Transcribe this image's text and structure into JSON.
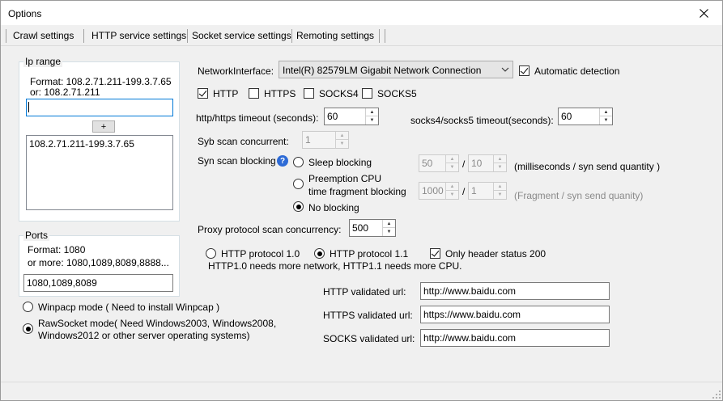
{
  "window": {
    "title": "Options",
    "close_icon": "close-icon"
  },
  "menu": [
    "Crawl settings",
    "HTTP service settings",
    "Socket service settings",
    "Remoting settings"
  ],
  "ip_range": {
    "group_label": "Ip range",
    "format_line1": "Format: 108.2.71.211-199.3.7.65",
    "format_line2": "or: 108.2.71.211",
    "input_value": "",
    "add_button": "+",
    "list_items": [
      "108.2.71.211-199.3.7.65"
    ]
  },
  "ports": {
    "group_label": "Ports",
    "format_line1": "Format: 1080",
    "format_line2": "or more: 1080,1089,8089,8888...",
    "input_value": "1080,1089,8089"
  },
  "capture_mode": {
    "winpcap_label": "Winpacp mode ( Need to install Winpcap )",
    "rawsocket_line1": "RawSocket mode( Need Windows2003, Windows2008,",
    "rawsocket_line2": "Windows2012 or other server operating systems)",
    "selected": "rawsocket"
  },
  "network": {
    "label": "NetworkInterface:",
    "value": "Intel(R) 82579LM Gigabit Network Connection",
    "auto_detect_label": "Automatic detection",
    "auto_detect_checked": true
  },
  "protocols": [
    {
      "label": "HTTP",
      "checked": true
    },
    {
      "label": "HTTPS",
      "checked": false
    },
    {
      "label": "SOCKS4",
      "checked": false
    },
    {
      "label": "SOCKS5",
      "checked": false
    }
  ],
  "timeouts": {
    "http_label": "http/https timeout (seconds):",
    "http_value": "60",
    "socks_label": "socks4/socks5 timeout(seconds):",
    "socks_value": "60"
  },
  "syn": {
    "concurrent_label": "Syb scan concurrent:",
    "concurrent_value": "1",
    "blocking_label": "Syn scan blocking",
    "help_icon": "help-icon",
    "sleep_label": "Sleep blocking",
    "sleep_ms": "50",
    "sleep_qty": "10",
    "sleep_hint": "(milliseconds / syn send quantity )",
    "preempt_line1": "Preemption CPU",
    "preempt_line2": "time fragment blocking",
    "preempt_a": "1000",
    "preempt_b": "1",
    "preempt_hint": "(Fragment / syn send quanity)",
    "none_label": "No blocking",
    "selected": "none",
    "slash": "/"
  },
  "proxy": {
    "label": "Proxy protocol scan concurrency:",
    "value": "500"
  },
  "http_protocol": {
    "v10_label": "HTTP protocol 1.0",
    "v11_label": "HTTP protocol 1.1",
    "selected": "1.1",
    "only200_label": "Only header status 200",
    "only200_checked": true,
    "note": "HTTP1.0 needs more network, HTTP1.1 needs more CPU."
  },
  "urls": {
    "http_label": "HTTP validated url:",
    "http_value": "http://www.baidu.com",
    "https_label": "HTTPS validated url:",
    "https_value": "https://www.baidu.com",
    "socks_label": "SOCKS validated url:",
    "socks_value": "http://www.baidu.com"
  }
}
